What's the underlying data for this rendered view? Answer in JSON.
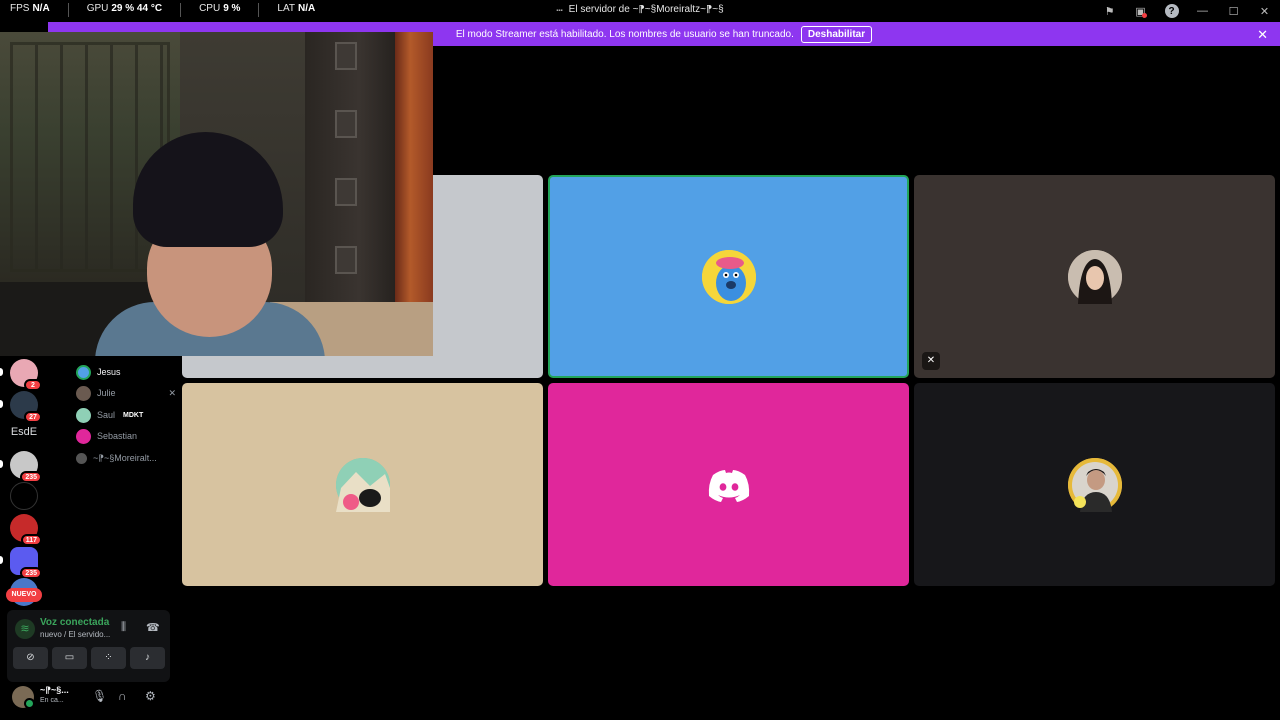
{
  "overlay": {
    "fps_label": "FPS",
    "fps_value": "N/A",
    "gpu_label": "GPU",
    "gpu_value": "29 % 44 °C",
    "cpu_label": "CPU",
    "cpu_value": "9 %",
    "lat_label": "LAT",
    "lat_value": "N/A"
  },
  "window": {
    "title": "El servidor de ~⁋~§Moreiraltz~⁋~§",
    "icons": [
      "flag-icon",
      "inbox-icon",
      "help-icon",
      "minimize-icon",
      "maximize-icon",
      "close-icon"
    ],
    "help_glyph": "?"
  },
  "banner": {
    "message": "El modo Streamer está habilitado. Los nombres de usuario se han truncado.",
    "button_label": "Deshabilitar",
    "color": "#8e36f0"
  },
  "servers": [
    {
      "badge": "2"
    },
    {
      "badge": "27"
    },
    {
      "label": "EsdE"
    },
    {
      "badge": "235"
    },
    {
      "badge": ""
    },
    {
      "badge": "117"
    },
    {
      "badge": "235"
    },
    {
      "badge": ""
    }
  ],
  "new_badge": "NUEVO",
  "voice_users": [
    {
      "name": "Jesus",
      "active": true
    },
    {
      "name": "Julie",
      "muted": true
    },
    {
      "name": "Saul",
      "tag": "MDKT"
    },
    {
      "name": "Sebastian"
    },
    {
      "name": "~⁋~§Moreiralt..."
    }
  ],
  "voice_panel": {
    "status": "Voz conectada",
    "channel": "nuevo / El servido..."
  },
  "user": {
    "name": "~⁋~§...",
    "status": "En ca..."
  },
  "tiles": [
    {
      "id": "tile-1",
      "color": "#c5c8cc"
    },
    {
      "id": "tile-2",
      "color": "#52a0e6",
      "speaking": true
    },
    {
      "id": "tile-3",
      "color": "#3a3330",
      "muted": true
    },
    {
      "id": "tile-4",
      "color": "#d7c3a0"
    },
    {
      "id": "tile-5",
      "color": "#e0279b"
    },
    {
      "id": "tile-6",
      "color": "#17171a"
    }
  ]
}
